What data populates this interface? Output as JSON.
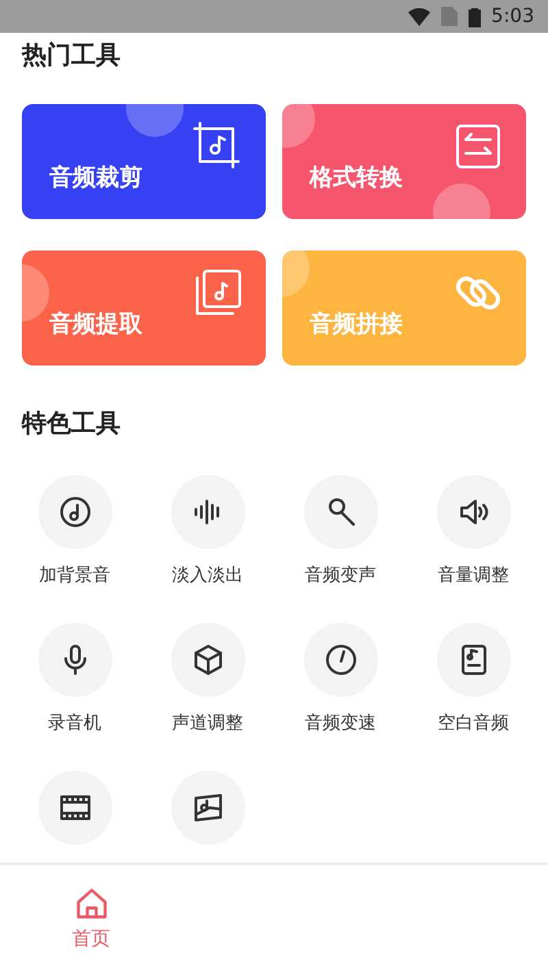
{
  "status_bar": {
    "time": "5:03"
  },
  "hot_tools": {
    "title": "热门工具",
    "cards": [
      {
        "label": "音频裁剪",
        "color": "#3541f2"
      },
      {
        "label": "格式转换",
        "color": "#f5566e"
      },
      {
        "label": "音频提取",
        "color": "#fb634a"
      },
      {
        "label": "音频拼接",
        "color": "#fdb540"
      }
    ]
  },
  "featured_tools": {
    "title": "特色工具",
    "items": [
      {
        "label": "加背景音"
      },
      {
        "label": "淡入淡出"
      },
      {
        "label": "音频变声"
      },
      {
        "label": "音量调整"
      },
      {
        "label": "录音机"
      },
      {
        "label": "声道调整"
      },
      {
        "label": "音频变速"
      },
      {
        "label": "空白音频"
      }
    ]
  },
  "bottom_nav": [
    {
      "label": "首页",
      "selected": true
    }
  ]
}
